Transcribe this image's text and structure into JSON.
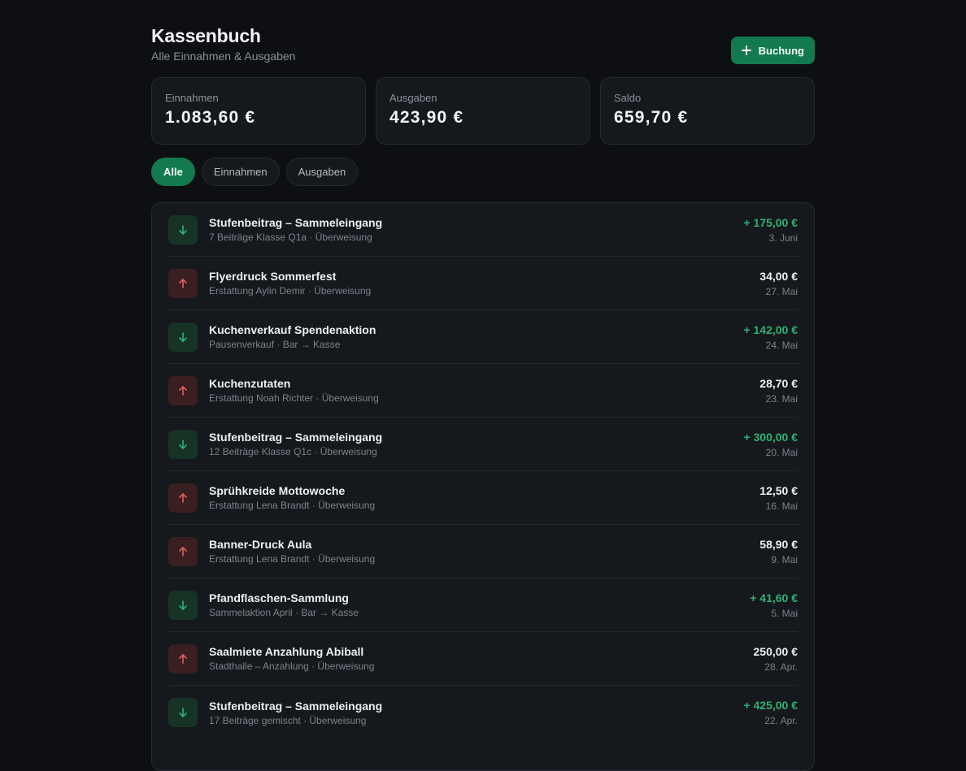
{
  "header": {
    "title": "Kassenbuch",
    "subtitle": "Alle Einnahmen & Ausgaben",
    "add_button_label": "Buchung",
    "add_icon": "plus-icon"
  },
  "summary": [
    {
      "label": "Einnahmen",
      "value": "1.083,60 €"
    },
    {
      "label": "Ausgaben",
      "value": "423,90 €"
    },
    {
      "label": "Saldo",
      "value": "659,70 €"
    }
  ],
  "filters": [
    {
      "label": "Alle",
      "active": true
    },
    {
      "label": "Einnahmen",
      "active": false
    },
    {
      "label": "Ausgaben",
      "active": false
    }
  ],
  "colors": {
    "accent": "#137a4f",
    "income": "#2fb174",
    "expense": "#e0605a"
  },
  "transactions": [
    {
      "type": "in",
      "icon": "arrow-down-icon",
      "title": "Stufenbeitrag – Sammeleingang",
      "sub": "7 Beiträge Klasse Q1a · Überweisung",
      "amount": "+ 175,00 €",
      "date": "3. Juni"
    },
    {
      "type": "out",
      "icon": "arrow-up-icon",
      "title": "Flyerdruck Sommerfest",
      "sub": "Erstattung Aylin Demir · Überweisung",
      "amount": "34,00 €",
      "date": "27. Mai"
    },
    {
      "type": "in",
      "icon": "arrow-down-icon",
      "title": "Kuchenverkauf Spendenaktion",
      "sub": "Pausenverkauf · Bar → Kasse",
      "amount": "+ 142,00 €",
      "date": "24. Mai"
    },
    {
      "type": "out",
      "icon": "arrow-up-icon",
      "title": "Kuchenzutaten",
      "sub": "Erstattung Noah Richter · Überweisung",
      "amount": "28,70 €",
      "date": "23. Mai"
    },
    {
      "type": "in",
      "icon": "arrow-down-icon",
      "title": "Stufenbeitrag – Sammeleingang",
      "sub": "12 Beiträge Klasse Q1c · Überweisung",
      "amount": "+ 300,00 €",
      "date": "20. Mai"
    },
    {
      "type": "out",
      "icon": "arrow-up-icon",
      "title": "Sprühkreide Mottowoche",
      "sub": "Erstattung Lena Brandt · Überweisung",
      "amount": "12,50 €",
      "date": "16. Mai"
    },
    {
      "type": "out",
      "icon": "arrow-up-icon",
      "title": "Banner-Druck Aula",
      "sub": "Erstattung Lena Brandt · Überweisung",
      "amount": "58,90 €",
      "date": "9. Mai"
    },
    {
      "type": "in",
      "icon": "arrow-down-icon",
      "title": "Pfandflaschen-Sammlung",
      "sub": "Sammelaktion April · Bar → Kasse",
      "amount": "+ 41,60 €",
      "date": "5. Mai"
    },
    {
      "type": "out",
      "icon": "arrow-up-icon",
      "title": "Saalmiete Anzahlung Abiball",
      "sub": "Stadthalle – Anzahlung · Überweisung",
      "amount": "250,00 €",
      "date": "28. Apr."
    },
    {
      "type": "in",
      "icon": "arrow-down-icon",
      "title": "Stufenbeitrag – Sammeleingang",
      "sub": "17 Beiträge gemischt · Überweisung",
      "amount": "+ 425,00 €",
      "date": "22. Apr."
    }
  ]
}
